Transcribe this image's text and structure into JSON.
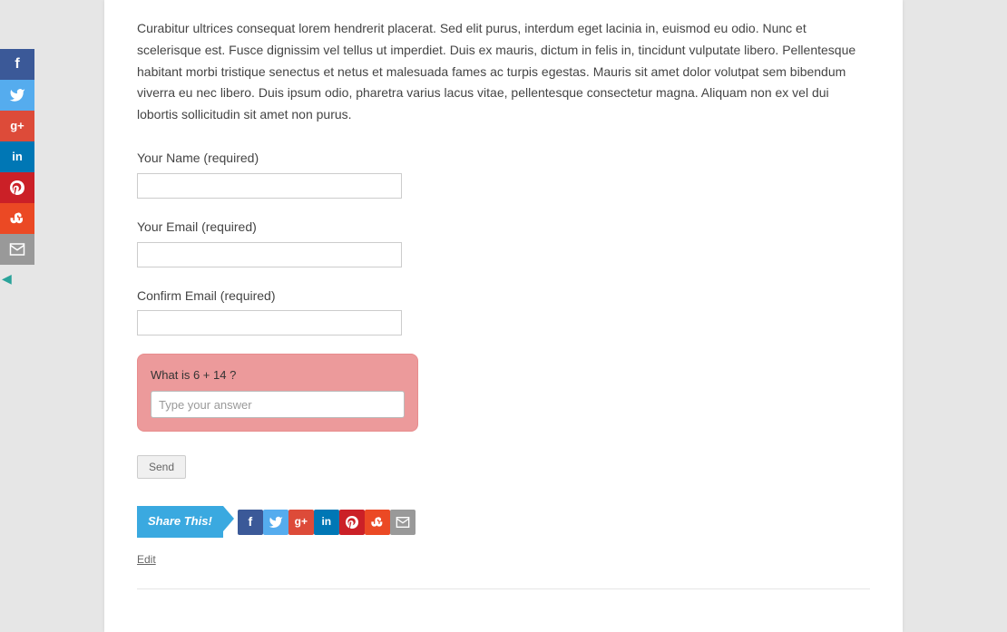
{
  "body_text": "Curabitur ultrices consequat lorem hendrerit placerat. Sed elit purus, interdum eget lacinia in, euismod eu odio. Nunc et scelerisque est. Fusce dignissim vel tellus ut imperdiet. Duis ex mauris, dictum in felis in, tincidunt vulputate libero. Pellentesque habitant morbi tristique senectus et netus et malesuada fames ac turpis egestas. Mauris sit amet dolor volutpat sem bibendum viverra eu nec libero. Duis ipsum odio, pharetra varius lacus vitae, pellentesque consectetur magna. Aliquam non ex vel dui lobortis sollicitudin sit amet non purus.",
  "form": {
    "name_label": "Your Name (required)",
    "email_label": "Your Email (required)",
    "confirm_label": "Confirm Email (required)",
    "captcha_label": "What is 6 + 14 ?",
    "captcha_placeholder": "Type your answer",
    "send_label": "Send"
  },
  "share": {
    "badge": "Share This!",
    "icons": {
      "facebook": "f",
      "twitter": "tw",
      "gplus": "g+",
      "linkedin": "in",
      "pinterest": "p",
      "stumble": "su",
      "mail": "mail"
    }
  },
  "edit_label": "Edit"
}
